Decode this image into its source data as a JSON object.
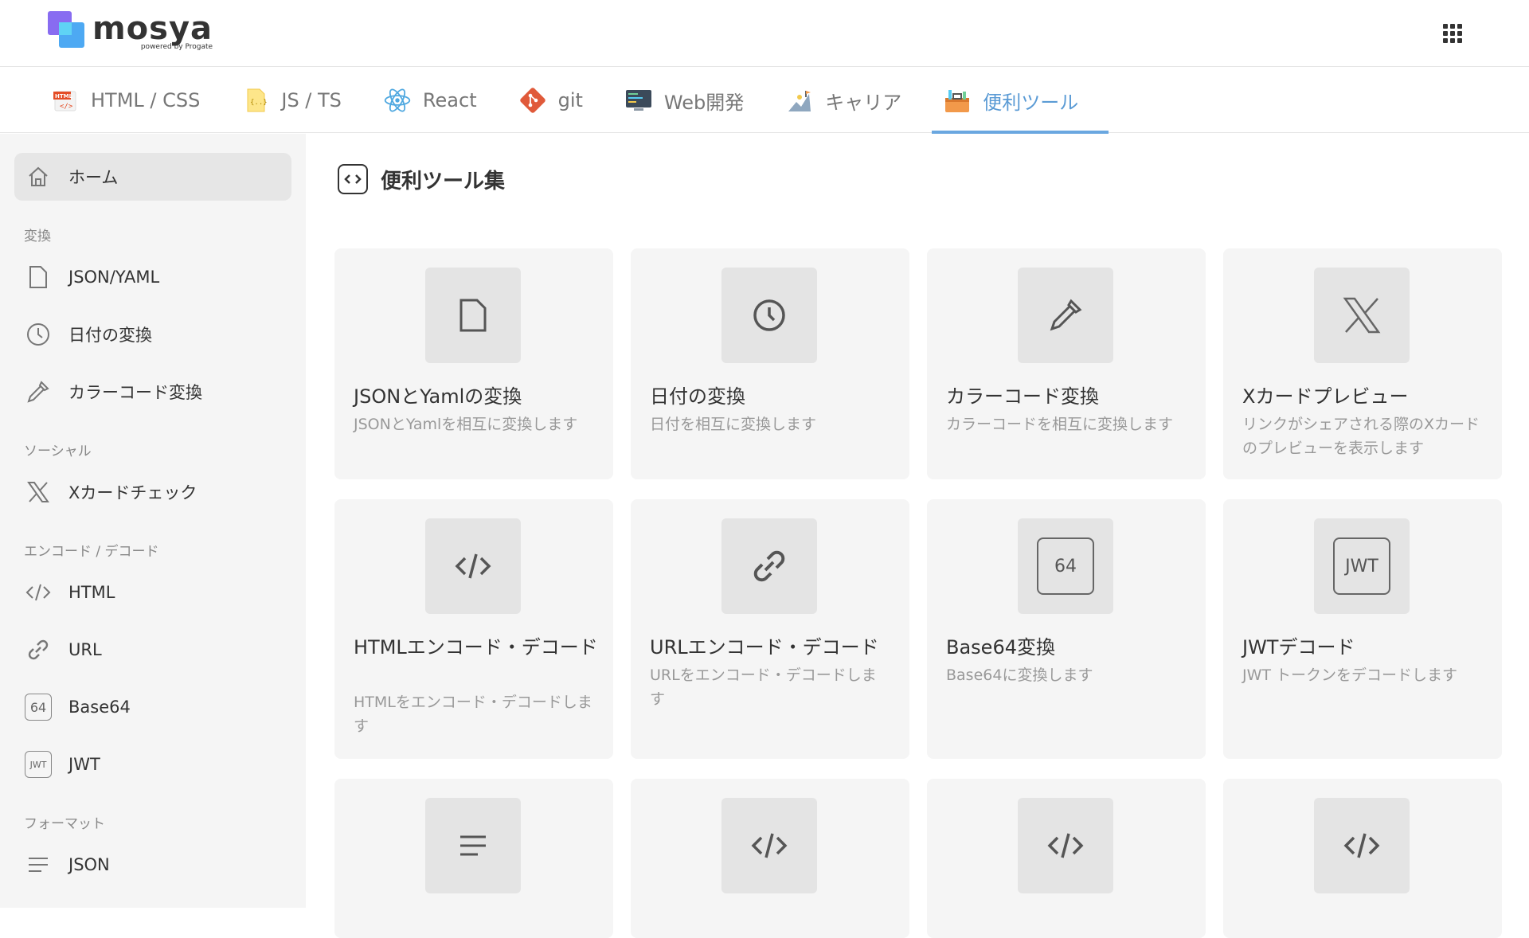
{
  "header": {
    "logo_word": "mosya",
    "logo_sub": "powered by Progate"
  },
  "tabs": [
    {
      "label": "HTML / CSS",
      "icon": "html-css-icon"
    },
    {
      "label": "JS / TS",
      "icon": "js-ts-icon"
    },
    {
      "label": "React",
      "icon": "react-icon"
    },
    {
      "label": "git",
      "icon": "git-icon"
    },
    {
      "label": "Web開発",
      "icon": "web-dev-icon"
    },
    {
      "label": "キャリア",
      "icon": "career-icon"
    },
    {
      "label": "便利ツール",
      "icon": "tools-icon",
      "active": true
    }
  ],
  "sidebar": {
    "home": "ホーム",
    "sections": {
      "convert": "変換",
      "social": "ソーシャル",
      "encode": "エンコード / デコード",
      "format": "フォーマット"
    },
    "items": {
      "json_yaml": "JSON/YAML",
      "date": "日付の変換",
      "color": "カラーコード変換",
      "xcard": "Xカードチェック",
      "html": "HTML",
      "url": "URL",
      "base64": "Base64",
      "jwt": "JWT",
      "json": "JSON"
    },
    "icon_text": {
      "base64": "64",
      "jwt": "JWT"
    }
  },
  "main": {
    "title": "便利ツール集",
    "cards": [
      {
        "title": "JSONとYamlの変換",
        "desc": "JSONとYamlを相互に変換します",
        "icon": "file-icon"
      },
      {
        "title": "日付の変換",
        "desc": "日付を相互に変換します",
        "icon": "clock-icon"
      },
      {
        "title": "カラーコード変換",
        "desc": "カラーコードを相互に変換します",
        "icon": "eyedropper-icon"
      },
      {
        "title": "Xカードプレビュー",
        "desc": "リンクがシェアされる際のXカードのプレビューを表示します",
        "icon": "x-icon"
      },
      {
        "title": "HTMLエンコード・デコード",
        "desc": "HTMLをエンコード・デコードします",
        "icon": "code-icon"
      },
      {
        "title": "URLエンコード・デコード",
        "desc": "URLをエンコード・デコードします",
        "icon": "link-icon"
      },
      {
        "title": "Base64変換",
        "desc": "Base64に変換します",
        "icon": "base64-icon",
        "icon_text": "64"
      },
      {
        "title": "JWTデコード",
        "desc": "JWT トークンをデコードします",
        "icon": "jwt-icon",
        "icon_text": "JWT"
      },
      {
        "icon": "align-left-icon"
      },
      {
        "icon": "code-icon"
      },
      {
        "icon": "code-icon"
      },
      {
        "icon": "code-icon"
      }
    ]
  }
}
